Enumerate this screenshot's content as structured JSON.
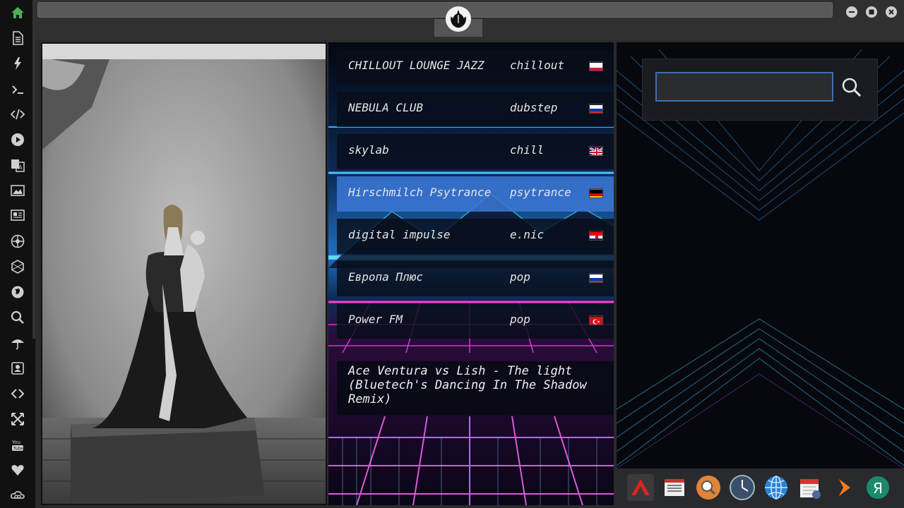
{
  "sidebar": {
    "items": [
      {
        "name": "home",
        "icon": "home-icon",
        "active": true
      },
      {
        "name": "document",
        "icon": "document-icon"
      },
      {
        "name": "flash",
        "icon": "lightning-icon"
      },
      {
        "name": "terminal",
        "icon": "terminal-icon"
      },
      {
        "name": "code",
        "icon": "code-icon"
      },
      {
        "name": "play",
        "icon": "play-icon"
      },
      {
        "name": "translate",
        "icon": "translate-icon"
      },
      {
        "name": "image",
        "icon": "image-icon"
      },
      {
        "name": "news",
        "icon": "newspaper-icon"
      },
      {
        "name": "aperture",
        "icon": "aperture-icon"
      },
      {
        "name": "hexagon",
        "icon": "hexagon-icon"
      },
      {
        "name": "globe",
        "icon": "globe-icon"
      },
      {
        "name": "search",
        "icon": "search-icon"
      },
      {
        "name": "umbrella",
        "icon": "umbrella-icon"
      },
      {
        "name": "contact",
        "icon": "contact-card-icon"
      },
      {
        "name": "embed",
        "icon": "embed-icon"
      },
      {
        "name": "expand",
        "icon": "expand-icon"
      },
      {
        "name": "youtube",
        "icon": "youtube-icon"
      },
      {
        "name": "favorites",
        "icon": "heart-icon"
      },
      {
        "name": "cloud",
        "icon": "cloud-link-icon"
      }
    ]
  },
  "window": {
    "title_value": "",
    "logo_icon": "rebel-alliance-logo-icon",
    "buttons": [
      "minimize-icon",
      "maximize-icon",
      "close-icon"
    ]
  },
  "stations": [
    {
      "name": "CHILLOUT LOUNGE JAZZ",
      "genre": "chillout",
      "flag": "poland-flag-icon"
    },
    {
      "name": "NEBULA CLUB",
      "genre": "dubstep",
      "flag": "russia-flag-icon"
    },
    {
      "name": "skylab",
      "genre": "chill",
      "flag": "uk-flag-icon"
    },
    {
      "name": "Hirschmilch Psytrance",
      "genre": "psytrance",
      "flag": "germany-flag-icon",
      "active": true
    },
    {
      "name": "digital impulse",
      "genre": "e.nic",
      "flag": "croatia-flag-icon"
    },
    {
      "name": "Европа Плюс",
      "genre": "pop",
      "flag": "russia-flag-icon"
    },
    {
      "name": "Power FM",
      "genre": "pop",
      "flag": "turkey-flag-icon"
    }
  ],
  "now_playing": {
    "title": "Ace Ventura vs Lish - The light (Bluetech's Dancing In The Shadow Remix)"
  },
  "search": {
    "value": "",
    "placeholder": "",
    "button_icon": "search-icon"
  },
  "dock": {
    "items": [
      {
        "name": "app-launcher",
        "icon": "red-triangle-app-icon"
      },
      {
        "name": "news-reader",
        "icon": "newspaper-app-icon"
      },
      {
        "name": "search-app",
        "icon": "magnifier-app-icon"
      },
      {
        "name": "clock-app",
        "icon": "clock-app-icon"
      },
      {
        "name": "browser",
        "icon": "globe-app-icon"
      },
      {
        "name": "calendar",
        "icon": "calendar-app-icon"
      },
      {
        "name": "terminal-app",
        "icon": "arrow-app-icon"
      },
      {
        "name": "yandex",
        "icon": "yandex-app-icon"
      }
    ]
  },
  "colors": {
    "accent": "#3e6fb3",
    "active_row": "#3c78d7",
    "sidebar_active": "#4caf50",
    "neon_pink": "#e040c0",
    "neon_cyan": "#30c8ff"
  }
}
